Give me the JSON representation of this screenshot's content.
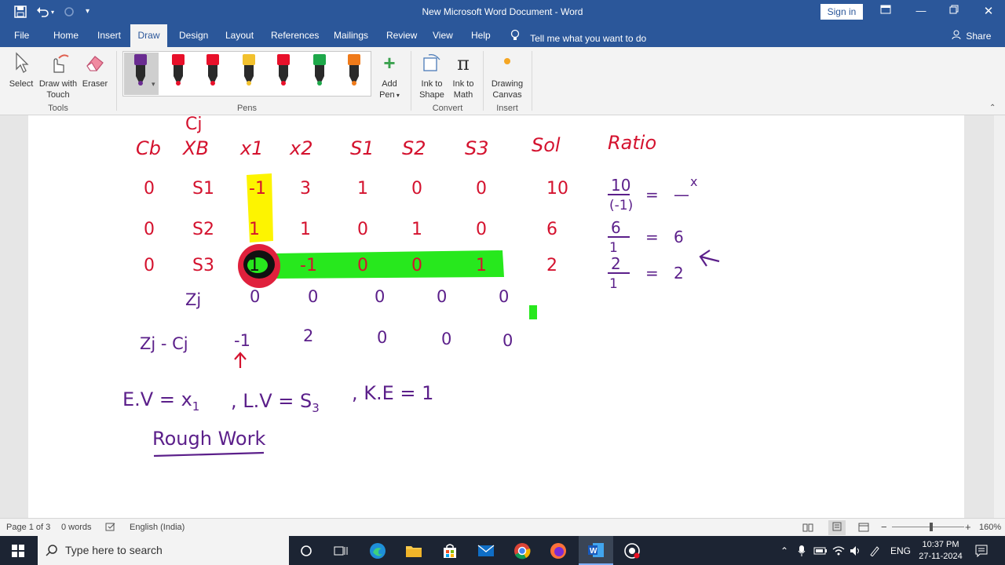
{
  "window": {
    "title": "New Microsoft Word Document  -  Word",
    "sign_in": "Sign in"
  },
  "tabs": [
    {
      "label": "File"
    },
    {
      "label": "Home"
    },
    {
      "label": "Insert"
    },
    {
      "label": "Draw"
    },
    {
      "label": "Design"
    },
    {
      "label": "Layout"
    },
    {
      "label": "References"
    },
    {
      "label": "Mailings"
    },
    {
      "label": "Review"
    },
    {
      "label": "View"
    },
    {
      "label": "Help"
    }
  ],
  "tell_me": "Tell me what you want to do",
  "share": "Share",
  "ribbon": {
    "select": "Select",
    "draw_with_touch_1": "Draw with",
    "draw_with_touch_2": "Touch",
    "eraser": "Eraser",
    "tools_label": "Tools",
    "pens_label": "Pens",
    "add_pen_1": "Add",
    "add_pen_2": "Pen",
    "ink_to_shape_1": "Ink to",
    "ink_to_shape_2": "Shape",
    "ink_to_math_1": "Ink to",
    "ink_to_math_2": "Math",
    "convert_label": "Convert",
    "drawing_canvas_1": "Drawing",
    "drawing_canvas_2": "Canvas",
    "insert_label": "Insert",
    "pens": [
      {
        "color": "#6a2c91",
        "selected": true
      },
      {
        "color": "#e8102a"
      },
      {
        "color": "#e8102a"
      },
      {
        "color": "#f2c12e"
      },
      {
        "color": "#e8102a"
      },
      {
        "color": "#1ea84a"
      },
      {
        "color": "#ef7a1a"
      }
    ]
  },
  "document": {
    "row_cj": "Cj",
    "headers": [
      "Cb",
      "XB",
      "x1",
      "x2",
      "S1",
      "S2",
      "S3",
      "Sol",
      "Ratio"
    ],
    "rows": [
      [
        "0",
        "S1",
        "-1",
        "3",
        "1",
        "0",
        "0",
        "10"
      ],
      [
        "0",
        "S2",
        "1",
        "1",
        "0",
        "1",
        "0",
        "6"
      ],
      [
        "0",
        "S3",
        "1",
        "-1",
        "0",
        "0",
        "1",
        "2"
      ]
    ],
    "zj_label": "Zj",
    "zj": [
      "0",
      "0",
      "0",
      "0",
      "0"
    ],
    "zjcj_label": "Zj - Cj",
    "zjcj": [
      "-1",
      "2",
      "0",
      "0",
      "0"
    ],
    "ratios": [
      {
        "num": "10",
        "den": "(-1)",
        "eq": "=",
        "res": "—",
        "mark": "x"
      },
      {
        "num": "6",
        "den": "1",
        "eq": "=",
        "res": "6"
      },
      {
        "num": "2",
        "den": "1",
        "eq": "=",
        "res": "2"
      }
    ],
    "ev_line": "E.V = x",
    "ev_sub": "1",
    "lv_line": ", L.V = S",
    "lv_sub": "3",
    "ke_line": ", K.E = 1",
    "rough_work": "Rough Work",
    "colors": {
      "red": "#d4122e",
      "purple": "#5b1f8a",
      "yellow": "#fdf400",
      "green": "#27e81d"
    }
  },
  "status": {
    "page": "Page 1 of 3",
    "words": "0 words",
    "language": "English (India)",
    "zoom": "160%"
  },
  "taskbar": {
    "search_placeholder": "Type here to search",
    "lang": "ENG",
    "time": "10:37 PM",
    "date": "27-11-2024"
  }
}
